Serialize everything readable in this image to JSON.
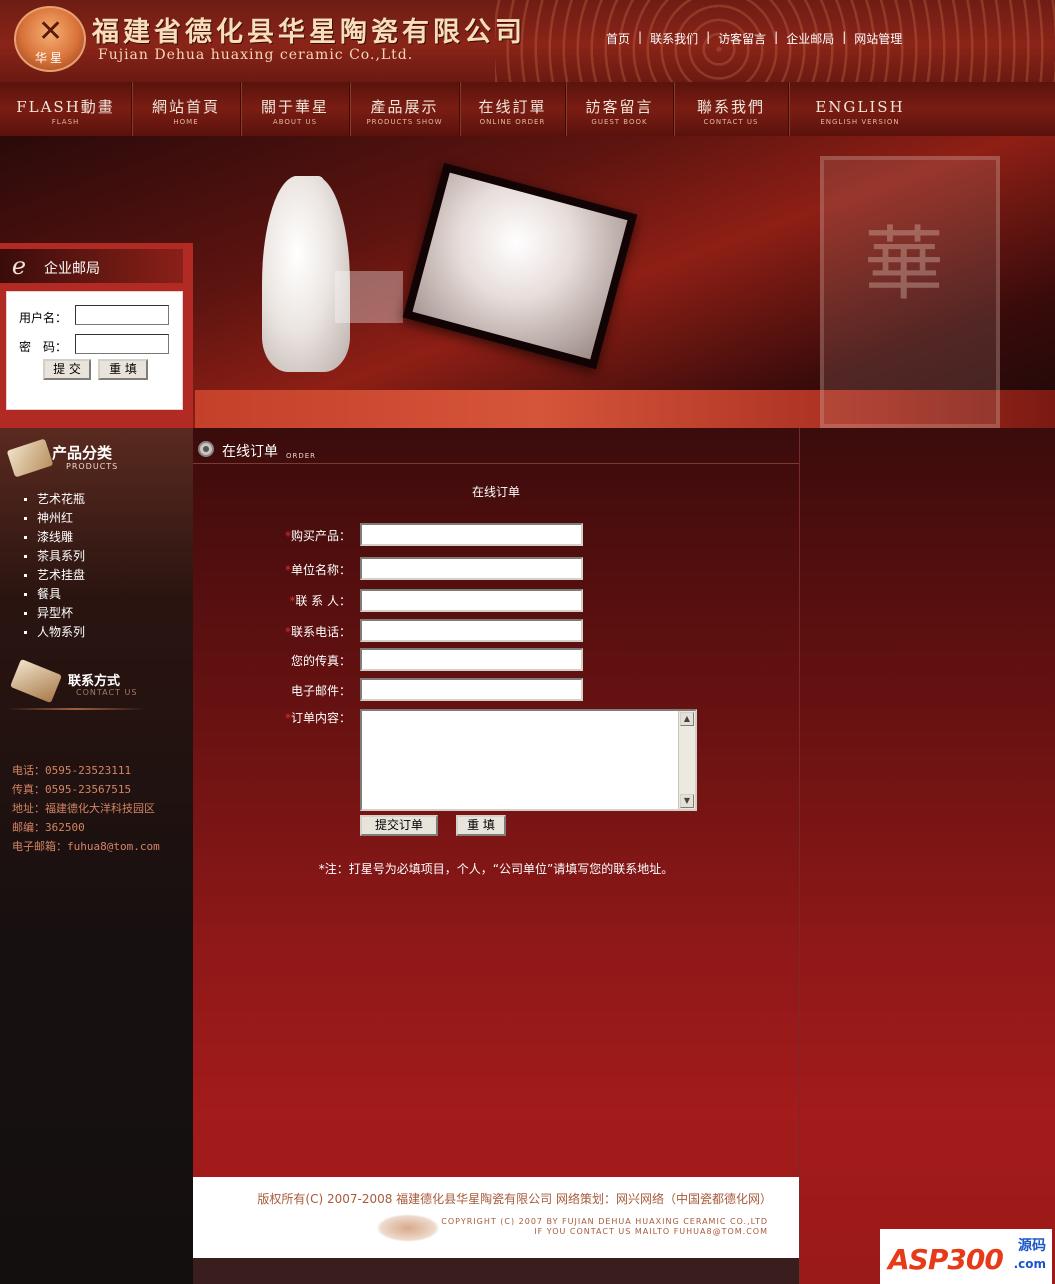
{
  "header": {
    "logo_caption": "华星",
    "company_cn": "福建省德化县华星陶瓷有限公司",
    "company_en": "Fujian Dehua huaxing ceramic  Co.,Ltd.",
    "links": [
      "首页",
      "联系我们",
      "访客留言",
      "企业邮局",
      "网站管理"
    ]
  },
  "nav": [
    {
      "cn": "FLASH動畫",
      "en": "FLASH"
    },
    {
      "cn": "網站首頁",
      "en": "HOME"
    },
    {
      "cn": "關于華星",
      "en": "ABOUT US"
    },
    {
      "cn": "產品展示",
      "en": "PRODUCTS SHOW"
    },
    {
      "cn": "在线訂單",
      "en": "ONLINE ORDER"
    },
    {
      "cn": "訪客留言",
      "en": "GUEST BOOK"
    },
    {
      "cn": "聯系我們",
      "en": "CONTACT US"
    },
    {
      "cn": "ENGLISH",
      "en": "ENGLISH VERSION"
    }
  ],
  "mail": {
    "title": "企业邮局",
    "username_label": "用户名：",
    "password_label": "密　码：",
    "submit": "提 交",
    "reset": "重 填"
  },
  "products": {
    "title": "产品分类",
    "subtitle": "PRODUCTS",
    "items": [
      "艺术花瓶",
      "神州红",
      "漆线雕",
      "茶具系列",
      "艺术挂盘",
      "餐具",
      "异型杯",
      "人物系列"
    ]
  },
  "contact": {
    "title": "联系方式",
    "subtitle": "CONTACT US",
    "lines": [
      "电话：0595-23523111",
      "传真：0595-23567515",
      "地址：福建德化大洋科技园区",
      "邮编：362500",
      "电子邮箱：fuhua8@tom.com"
    ]
  },
  "order": {
    "section_title": "在线订单",
    "section_sub": "ORDER",
    "form_title": "在线订单",
    "fields": [
      {
        "label": "购买产品：",
        "required": true,
        "value": ""
      },
      {
        "label": "单位名称：",
        "required": true,
        "value": ""
      },
      {
        "label": "联 系 人：",
        "required": true,
        "value": ""
      },
      {
        "label": "联系电话：",
        "required": true,
        "value": ""
      },
      {
        "label": "您的传真：",
        "required": false,
        "value": ""
      },
      {
        "label": "电子邮件：",
        "required": false,
        "value": ""
      }
    ],
    "content_label": "订单内容：",
    "submit": "提交订单",
    "reset": "重 填",
    "note": "*注：打星号为必填项目，个人，“公司单位”请填写您的联系地址。"
  },
  "footer": {
    "copyright_cn": "版权所有(C) 2007-2008 福建德化县华星陶瓷有限公司 网络策划：网兴网络（中国瓷都德化网）",
    "copyright_en1": "COPYRIGHT (C) 2007 BY FUJIAN DEHUA HUAXING CERAMIC CO.,LTD",
    "copyright_en2": "IF YOU CONTACT US MAILTO  FUHUA8@TOM.COM"
  },
  "watermark": {
    "logo_a": "ASP",
    "logo_b": "300",
    "right_top": "源码",
    "right_bottom": ".com"
  }
}
